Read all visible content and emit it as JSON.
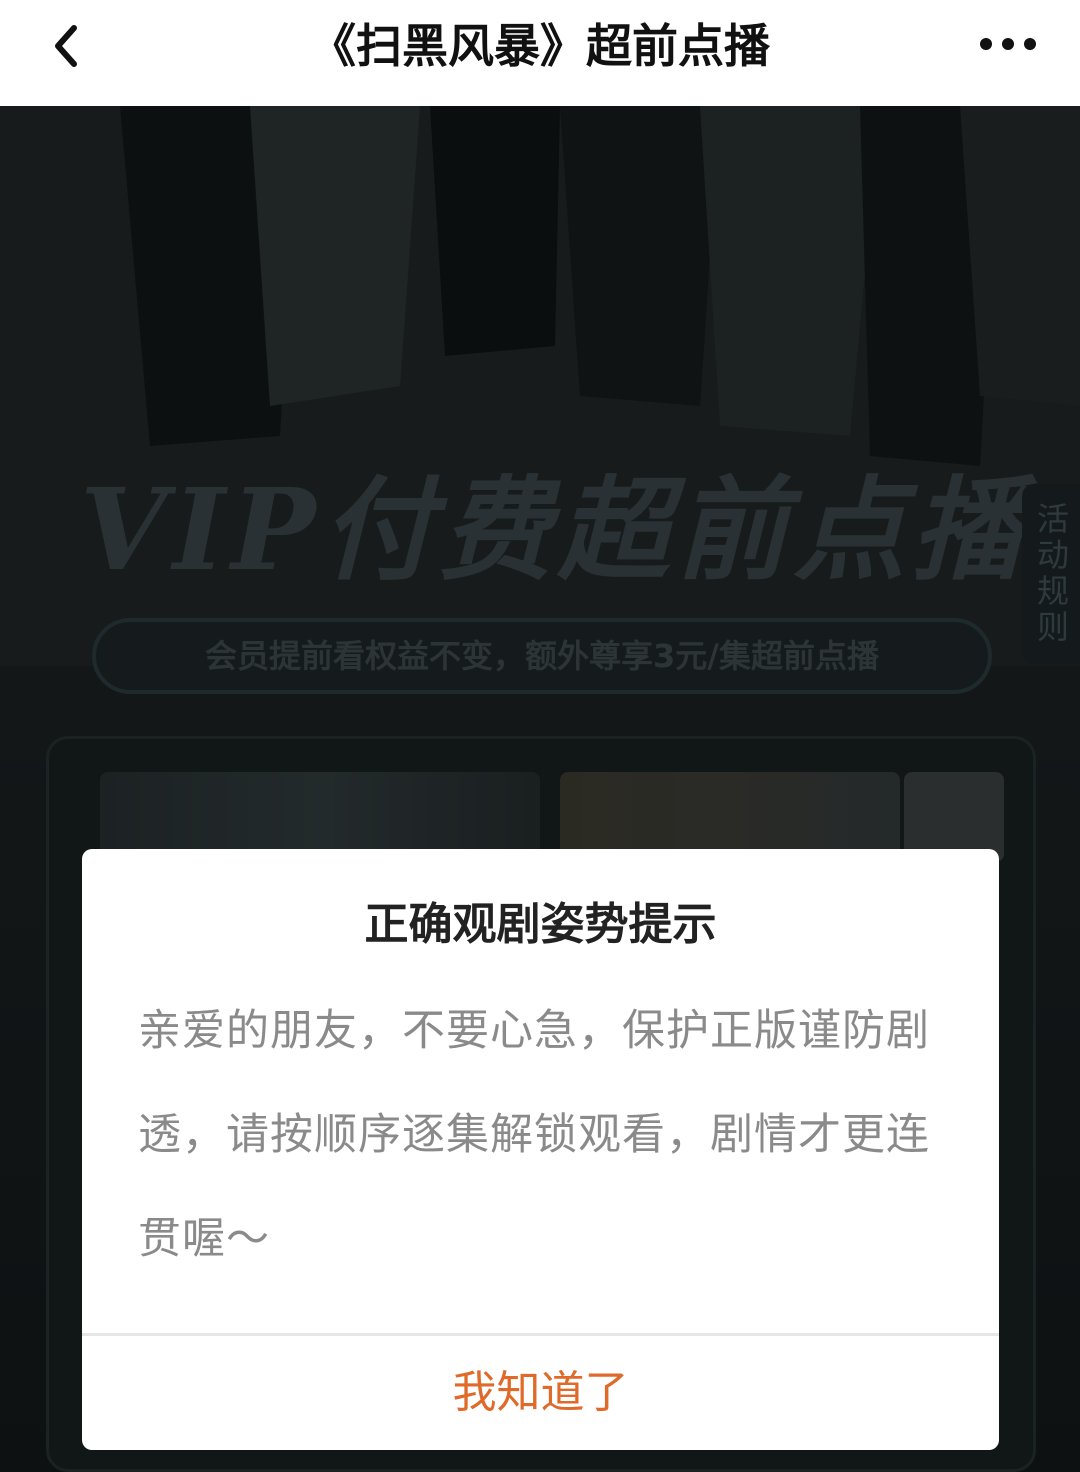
{
  "navbar": {
    "title": "《扫黑风暴》超前点播",
    "back_icon": "chevron-left-icon",
    "more_icon": "more-dots-icon"
  },
  "background": {
    "banner_title": "VIP付费超前点播",
    "promo_text": "会员提前看权益不变，额外尊享3元/集超前点播",
    "rules_tab": "活动规则"
  },
  "dialog": {
    "title": "正确观剧姿势提示",
    "body": "亲爱的朋友，不要心急，保护正版谨防剧透，请按顺序逐集解锁观看，剧情才更连贯喔～",
    "confirm_label": "我知道了",
    "accent_color": "#e06a2a"
  }
}
